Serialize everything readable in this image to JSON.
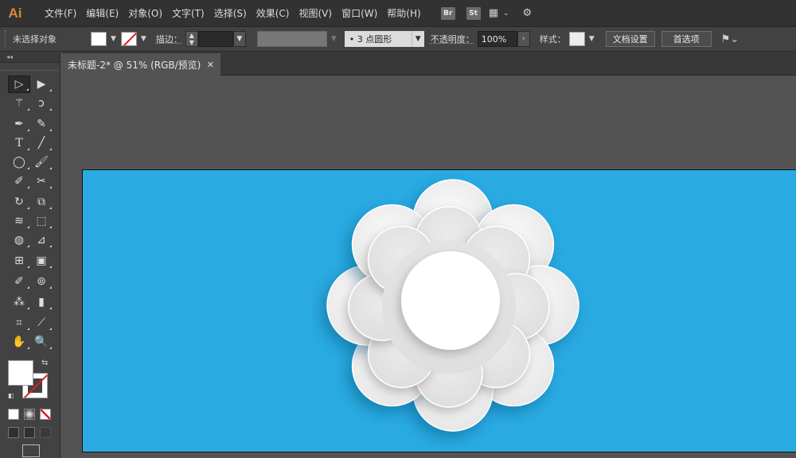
{
  "app": {
    "logo": "Ai"
  },
  "menu": {
    "items": [
      "文件(F)",
      "编辑(E)",
      "对象(O)",
      "文字(T)",
      "选择(S)",
      "效果(C)",
      "视图(V)",
      "窗口(W)",
      "帮助(H)"
    ],
    "bridge": "Br",
    "stock": "St"
  },
  "control": {
    "no_selection": "未选择对象",
    "stroke_label": "描边：",
    "brush": "•  3 点圆形",
    "opacity_label": "不透明度：",
    "opacity_value": "100%",
    "style_label": "样式：",
    "doc_setup": "文档设置",
    "preferences": "首选项"
  },
  "document": {
    "tab_title": "未标题-2* @ 51% (RGB/预览)",
    "close": "✕"
  },
  "artwork": {
    "background": "#29abe2",
    "flower_outer": "#f1f1f1",
    "flower_inner": "#e6e6e6",
    "center": "#ffffff"
  }
}
